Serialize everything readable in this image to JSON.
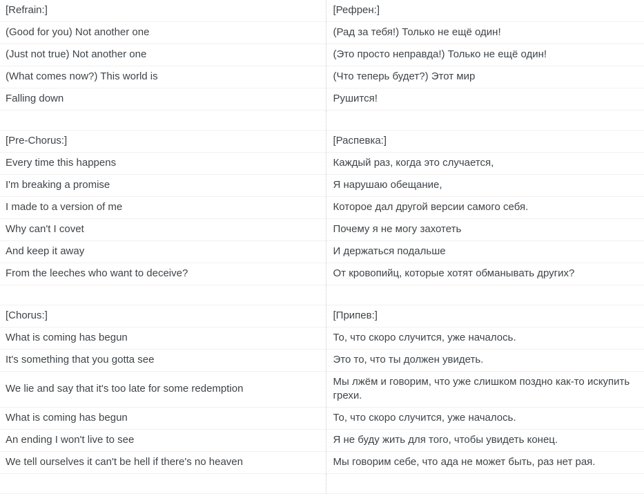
{
  "document": {
    "type": "bilingual-lyrics-table",
    "source_language": "English",
    "target_language": "Russian",
    "divider_style": "dotted",
    "colors": {
      "text": "#3f4448",
      "row_separator": "#f1f1f1",
      "column_divider": "#c9c9c9",
      "background": "#ffffff"
    }
  },
  "rows": [
    {
      "kind": "section",
      "source": "[Refrain:]",
      "target": "[Рефрен:]"
    },
    {
      "kind": "line",
      "source": "(Good for you) Not another one",
      "target": "(Рад за тебя!) Только не ещё один!"
    },
    {
      "kind": "line",
      "source": "(Just not true) Not another one",
      "target": "(Это просто неправда!) Только не ещё один!"
    },
    {
      "kind": "line",
      "source": "(What comes now?) This world is",
      "target": "(Что теперь будет?) Этот мир"
    },
    {
      "kind": "line",
      "source": "Falling down",
      "target": "Рушится!"
    },
    {
      "kind": "spacer",
      "source": "",
      "target": ""
    },
    {
      "kind": "section",
      "source": "[Pre-Chorus:]",
      "target": "[Распевка:]"
    },
    {
      "kind": "line",
      "source": "Every time this happens",
      "target": "Каждый раз, когда это случается,"
    },
    {
      "kind": "line",
      "source": "I'm breaking a promise",
      "target": "Я нарушаю обещание,"
    },
    {
      "kind": "line",
      "source": "I made to a version of me",
      "target": "Которое дал другой версии самого себя."
    },
    {
      "kind": "line",
      "source": "Why can't I covet",
      "target": "Почему я не могу захотеть"
    },
    {
      "kind": "line",
      "source": "And keep it away",
      "target": "И держаться подальше"
    },
    {
      "kind": "line",
      "source": "From the leeches who want to deceive?",
      "target": "От кровопийц, которые хотят обманывать других?"
    },
    {
      "kind": "spacer",
      "source": "",
      "target": ""
    },
    {
      "kind": "section",
      "source": "[Chorus:]",
      "target": "[Припев:]"
    },
    {
      "kind": "line",
      "source": "What is coming has begun",
      "target": "То, что скоро случится, уже началось."
    },
    {
      "kind": "line",
      "source": "It's something that you gotta see",
      "target": "Это то, что ты должен увидеть."
    },
    {
      "kind": "line",
      "source": "We lie and say that it's too late for some redemption",
      "target": "Мы лжём и говорим, что уже слишком поздно как-то искупить грехи."
    },
    {
      "kind": "line",
      "source": "What is coming has begun",
      "target": "То, что скоро случится, уже началось."
    },
    {
      "kind": "line",
      "source": "An ending I won't live to see",
      "target": "Я не буду жить для того, чтобы увидеть конец."
    },
    {
      "kind": "line",
      "source": "We tell ourselves it can't be hell if there's no heaven",
      "target": "Мы говорим себе, что ада не может быть, раз нет рая."
    },
    {
      "kind": "spacer",
      "source": "",
      "target": ""
    }
  ]
}
